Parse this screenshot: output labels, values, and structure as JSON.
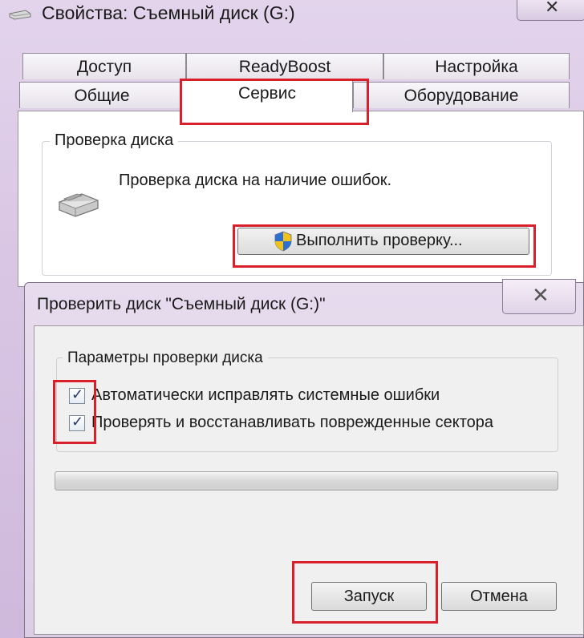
{
  "properties_window": {
    "title": "Свойства: Съемный диск (G:)",
    "close_glyph": "✕",
    "tabs_row1": [
      "Доступ",
      "ReadyBoost",
      "Настройка"
    ],
    "tabs_row2": [
      "Общие",
      "Сервис",
      "Оборудование"
    ],
    "active_tab": "Сервис",
    "check_group": {
      "label": "Проверка диска",
      "description": "Проверка диска на наличие ошибок.",
      "button": "Выполнить проверку..."
    }
  },
  "check_dialog": {
    "title": "Проверить диск \"Съемный диск (G:)\"",
    "close_glyph": "✕",
    "options_group": {
      "label": "Параметры проверки диска",
      "options": [
        {
          "label": "Автоматически исправлять системные ошибки",
          "checked": true
        },
        {
          "label": "Проверять и восстанавливать поврежденные сектора",
          "checked": true
        }
      ]
    },
    "progress": 0,
    "start_button": "Запуск",
    "cancel_button": "Отмена"
  },
  "colors": {
    "highlight": "#d9202a",
    "window_frame": "#dccde5"
  }
}
